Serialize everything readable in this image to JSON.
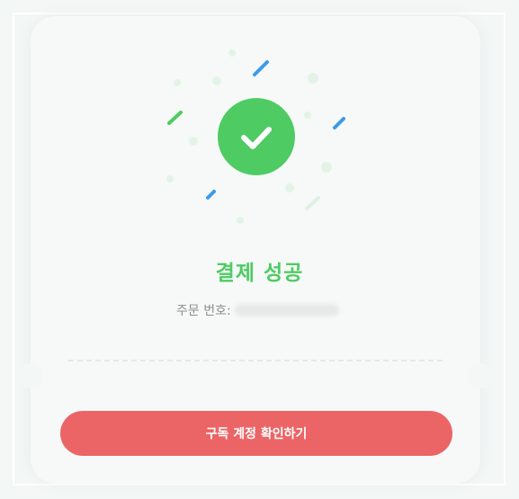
{
  "status": {
    "title": "결제 성공",
    "check_icon": "check-icon",
    "accent_color": "#4ecb63"
  },
  "order": {
    "label": "주문 번호:",
    "number_redacted": true
  },
  "cta": {
    "label": "구독 계정 확인하기",
    "color": "#ec6566"
  }
}
